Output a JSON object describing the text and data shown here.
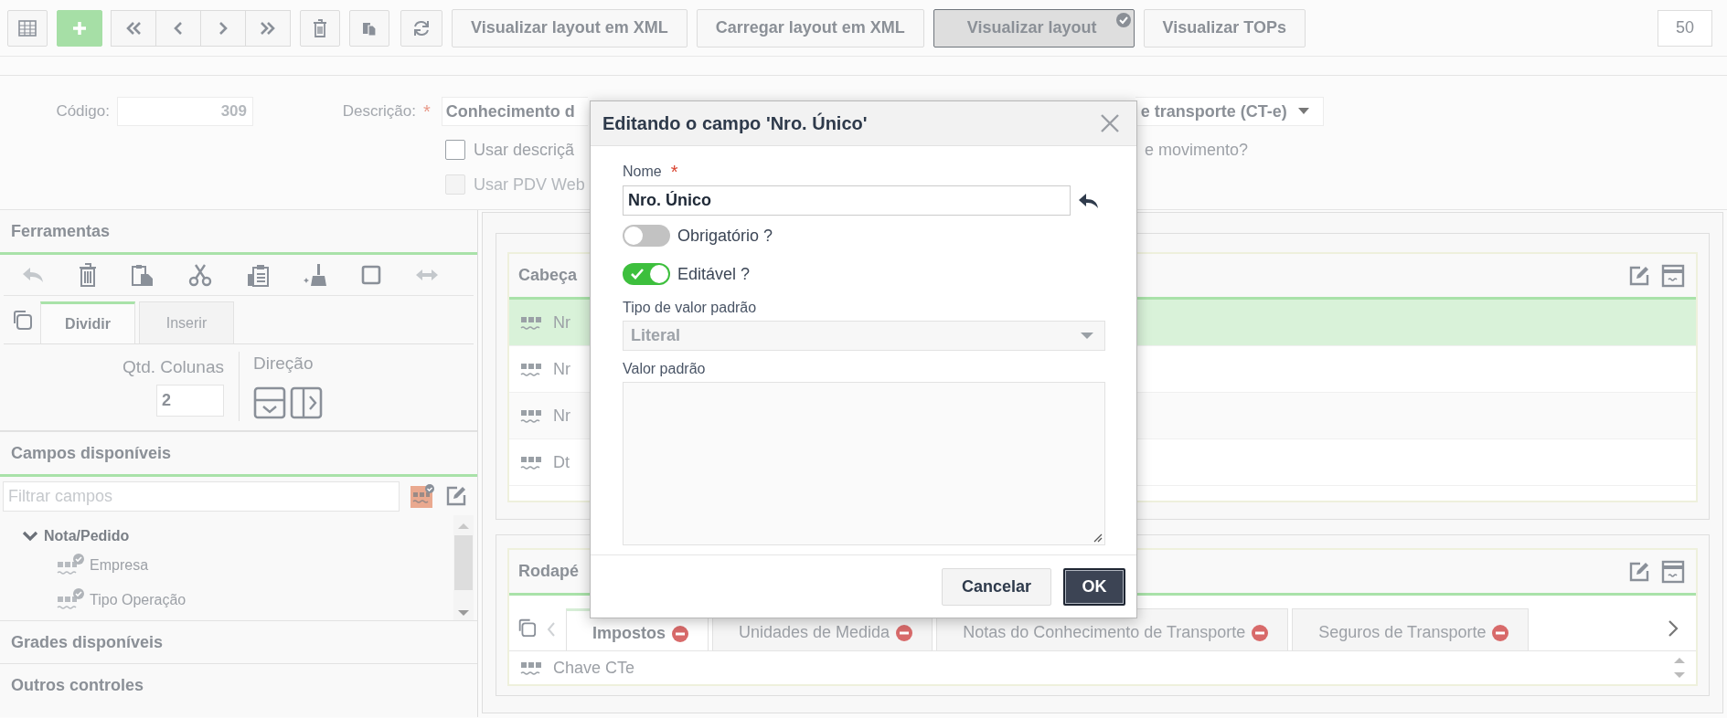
{
  "toolbar": {
    "buttons": [
      {
        "label": "Visualizar layout em XML",
        "pressed": false
      },
      {
        "label": "Carregar layout em XML",
        "pressed": false
      },
      {
        "label": "Visualizar layout",
        "pressed": true
      },
      {
        "label": "Visualizar TOPs",
        "pressed": false
      }
    ],
    "page_size": "50"
  },
  "form": {
    "code_label": "Código:",
    "code_value": "309",
    "description_label": "Descrição:",
    "required_mark": "*",
    "description_value": "Conhecimento d",
    "type_value": "e transporte (CT-e)",
    "checkboxes": [
      {
        "label": "Usar descriçã",
        "checked": false,
        "disabled": false
      },
      {
        "label": "Usar PDV Web",
        "checked": false,
        "disabled": true
      }
    ],
    "movement_text": "e movimento?"
  },
  "left_panel": {
    "tools_title": "Ferramentas",
    "tabs": [
      {
        "label": "Dividir",
        "selected": true
      },
      {
        "label": "Inserir",
        "selected": false
      }
    ],
    "columns_label": "Qtd. Colunas",
    "columns_value": "2",
    "direction_label": "Direção",
    "fields_title": "Campos disponíveis",
    "filter_placeholder": "Filtrar campos",
    "tree": [
      {
        "label": "Nota/Pedido",
        "expanded": true,
        "children": [
          {
            "label": "Empresa"
          },
          {
            "label": "Tipo Operação"
          }
        ]
      }
    ],
    "grids_title": "Grades disponíveis",
    "other_title": "Outros controles"
  },
  "canvas": {
    "header_panel": {
      "title": "Cabeça",
      "rows": [
        {
          "label": "Nr",
          "selected": true
        },
        {
          "label": "Nr",
          "selected": false
        },
        {
          "label": "Nr",
          "selected": false
        },
        {
          "label": "Dt",
          "selected": false
        }
      ]
    },
    "footer_panel": {
      "title": "Rodapé",
      "tabs": [
        {
          "label": "Impostos",
          "selected": true
        },
        {
          "label": "Unidades de Medida",
          "selected": false
        },
        {
          "label": "Notas do Conhecimento de Transporte",
          "selected": false
        },
        {
          "label": "Seguros de Transporte",
          "selected": false
        }
      ],
      "rows": [
        {
          "label": "Chave CTe"
        }
      ]
    }
  },
  "dialog": {
    "title": "Editando o campo 'Nro. Único'",
    "name_label": "Nome",
    "required_mark": "*",
    "name_value": "Nro. Único",
    "toggles": [
      {
        "label": "Obrigatório ?",
        "on": false
      },
      {
        "label": "Editável ?",
        "on": true
      }
    ],
    "default_type_label": "Tipo de valor padrão",
    "default_type_value": "Literal",
    "default_value_label": "Valor padrão",
    "buttons": [
      {
        "label": "Cancelar",
        "kind": "secondary"
      },
      {
        "label": "OK",
        "kind": "primary"
      }
    ]
  }
}
